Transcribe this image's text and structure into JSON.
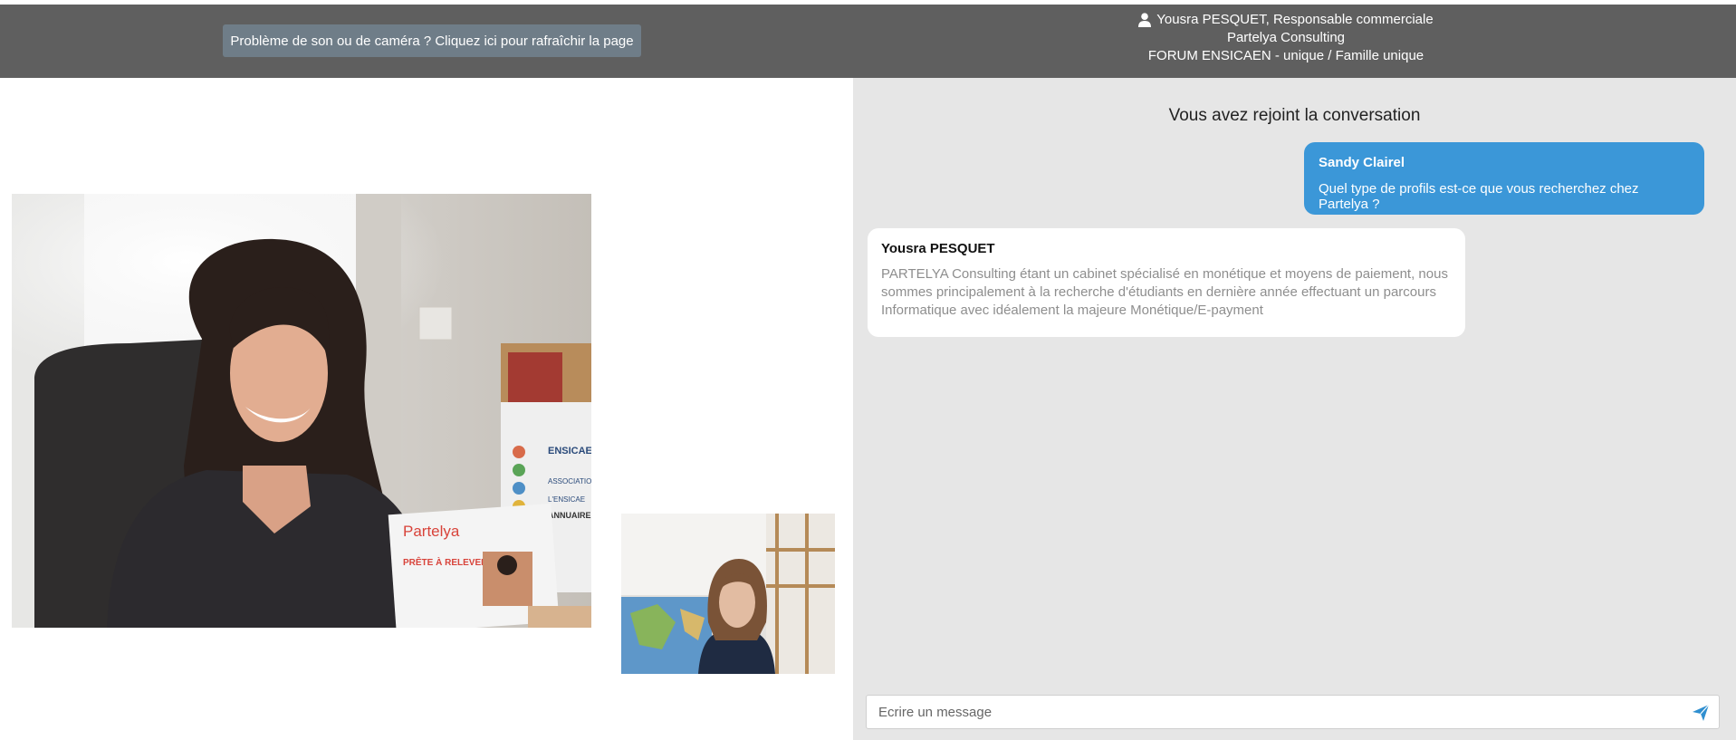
{
  "header": {
    "refresh_button_label": "Problème de son ou de caméra ? Cliquez ici pour rafraîchir la page",
    "rep_name_title": "Yousra PESQUET, Responsable commerciale",
    "company": "Partelya Consulting",
    "event": "FORUM ENSICAEN - unique / Famille unique",
    "user_icon": "user-icon"
  },
  "video": {
    "brochure_brand": "Partelya",
    "brochure_tagline": "PRÊTE À RELEVER",
    "poster_text_1": "ENSICAE",
    "poster_text_2": "ASSOCIATIO",
    "poster_text_3": "L'ENSICAE",
    "poster_text_4": "ANNUAIRE"
  },
  "chat": {
    "joined_text": "Vous avez rejoint la conversation",
    "messages": [
      {
        "author": "Sandy Clairel",
        "text": "Quel type de profils est-ce que vous recherchez chez Partelya ?",
        "side": "right"
      },
      {
        "author": "Yousra PESQUET",
        "text_lines": [
          "PARTELYA Consulting étant un cabinet spécialisé en monétique et moyens de paiement, nous",
          "sommes principalement à la recherche d'étudiants en dernière année effectuant un parcours",
          "Informatique avec idéalement la majeure Monétique/E-payment"
        ],
        "side": "left"
      }
    ],
    "composer_placeholder": "Ecrire un message",
    "send_icon": "send-icon"
  },
  "colors": {
    "header_bg": "#5f5f5f",
    "refresh_button_bg": "#6f7d88",
    "chat_bg": "#e6e6e6",
    "sent_bubble": "#3b97d8",
    "received_bubble": "#ffffff",
    "send_icon": "#2f8fd0"
  }
}
